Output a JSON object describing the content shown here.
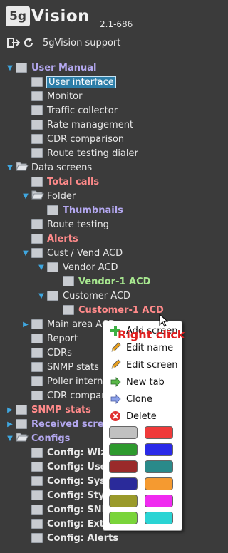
{
  "header": {
    "logo_badge": "5g",
    "logo_text": "Vision",
    "version": "2.1-686",
    "support_label": "5gVision support",
    "icons": [
      "logout-icon",
      "refresh-icon"
    ]
  },
  "tree": [
    {
      "label": "User Manual",
      "level": 0,
      "toggle": "open",
      "icon": "node",
      "style": "lav"
    },
    {
      "label": "User interface",
      "level": 1,
      "toggle": "none",
      "icon": "node",
      "style": "sel"
    },
    {
      "label": "Monitor",
      "level": 1,
      "toggle": "none",
      "icon": "node",
      "style": ""
    },
    {
      "label": "Traffic collector",
      "level": 1,
      "toggle": "none",
      "icon": "node",
      "style": ""
    },
    {
      "label": "Rate management",
      "level": 1,
      "toggle": "none",
      "icon": "node",
      "style": ""
    },
    {
      "label": "CDR comparison",
      "level": 1,
      "toggle": "none",
      "icon": "node",
      "style": ""
    },
    {
      "label": "Route testing dialer",
      "level": 1,
      "toggle": "none",
      "icon": "node",
      "style": ""
    },
    {
      "label": "Data screens",
      "level": 0,
      "toggle": "open",
      "icon": "folder",
      "style": ""
    },
    {
      "label": "Total calls",
      "level": 1,
      "toggle": "none",
      "icon": "node",
      "style": "pink"
    },
    {
      "label": "Folder",
      "level": 1,
      "toggle": "open",
      "icon": "folder",
      "style": ""
    },
    {
      "label": "Thumbnails",
      "level": 2,
      "toggle": "none",
      "icon": "node",
      "style": "lav"
    },
    {
      "label": "Route testing",
      "level": 1,
      "toggle": "none",
      "icon": "node",
      "style": ""
    },
    {
      "label": "Alerts",
      "level": 1,
      "toggle": "none",
      "icon": "node",
      "style": "pink"
    },
    {
      "label": "Cust / Vend ACD",
      "level": 1,
      "toggle": "open",
      "icon": "node",
      "style": ""
    },
    {
      "label": "Vendor ACD",
      "level": 2,
      "toggle": "open",
      "icon": "node",
      "style": ""
    },
    {
      "label": "Vendor-1 ACD",
      "level": 3,
      "toggle": "none",
      "icon": "node",
      "style": "green"
    },
    {
      "label": "Customer ACD",
      "level": 2,
      "toggle": "open",
      "icon": "node",
      "style": ""
    },
    {
      "label": "Customer-1 ACD",
      "level": 3,
      "toggle": "none",
      "icon": "node",
      "style": "pink"
    },
    {
      "label": "Main area ACD",
      "level": 1,
      "toggle": "closed",
      "icon": "node",
      "style": ""
    },
    {
      "label": "Report",
      "level": 1,
      "toggle": "none",
      "icon": "node",
      "style": ""
    },
    {
      "label": "CDRs",
      "level": 1,
      "toggle": "none",
      "icon": "node",
      "style": ""
    },
    {
      "label": "SNMP stats",
      "level": 1,
      "toggle": "none",
      "icon": "node",
      "style": ""
    },
    {
      "label": "Poller internal",
      "level": 1,
      "toggle": "none",
      "icon": "node",
      "style": ""
    },
    {
      "label": "CDR comparison",
      "level": 1,
      "toggle": "none",
      "icon": "node",
      "style": ""
    },
    {
      "label": "SNMP stats",
      "level": 0,
      "toggle": "closed",
      "icon": "node",
      "style": "pink"
    },
    {
      "label": "Received screens",
      "level": 0,
      "toggle": "closed",
      "icon": "node",
      "style": "lav"
    },
    {
      "label": "Configs",
      "level": 0,
      "toggle": "open",
      "icon": "folder",
      "style": "lav"
    },
    {
      "label": "Config: Wizard",
      "level": 1,
      "toggle": "none",
      "icon": "node",
      "style": "bold"
    },
    {
      "label": "Config: Users",
      "level": 1,
      "toggle": "none",
      "icon": "node",
      "style": "bold"
    },
    {
      "label": "Config: System",
      "level": 1,
      "toggle": "none",
      "icon": "node",
      "style": "bold"
    },
    {
      "label": "Config: Styles",
      "level": 1,
      "toggle": "none",
      "icon": "node",
      "style": "bold"
    },
    {
      "label": "Config: SNMP",
      "level": 1,
      "toggle": "none",
      "icon": "node",
      "style": "bold"
    },
    {
      "label": "Config: Extras",
      "level": 1,
      "toggle": "none",
      "icon": "node",
      "style": "bold"
    },
    {
      "label": "Config: Alerts",
      "level": 1,
      "toggle": "none",
      "icon": "node",
      "style": "bold"
    }
  ],
  "context_menu": {
    "items": [
      {
        "label": "Add screen",
        "icon": "plus-icon",
        "color": "#3cb043"
      },
      {
        "label": "Edit name",
        "icon": "pencil-icon",
        "color": "#e8a020"
      },
      {
        "label": "Edit screen",
        "icon": "pencil-icon",
        "color": "#e8a020"
      },
      {
        "label": "New tab",
        "icon": "arrow-right-green-icon",
        "color": "#5ab848"
      },
      {
        "label": "Clone",
        "icon": "arrow-right-blue-icon",
        "color": "#8aa0e8"
      },
      {
        "label": "Delete",
        "icon": "delete-icon",
        "color": "#e03030"
      }
    ],
    "colors": [
      "#c0c0c0",
      "#f03a3a",
      "#2e9a2e",
      "#2a2ae8",
      "#9a2a2a",
      "#2a8a8a",
      "#2a2a9a",
      "#f59a30",
      "#9a9a2a",
      "#f02af0",
      "#7ad43a",
      "#2ad4d4"
    ]
  },
  "annotation": {
    "text": "Right click"
  }
}
